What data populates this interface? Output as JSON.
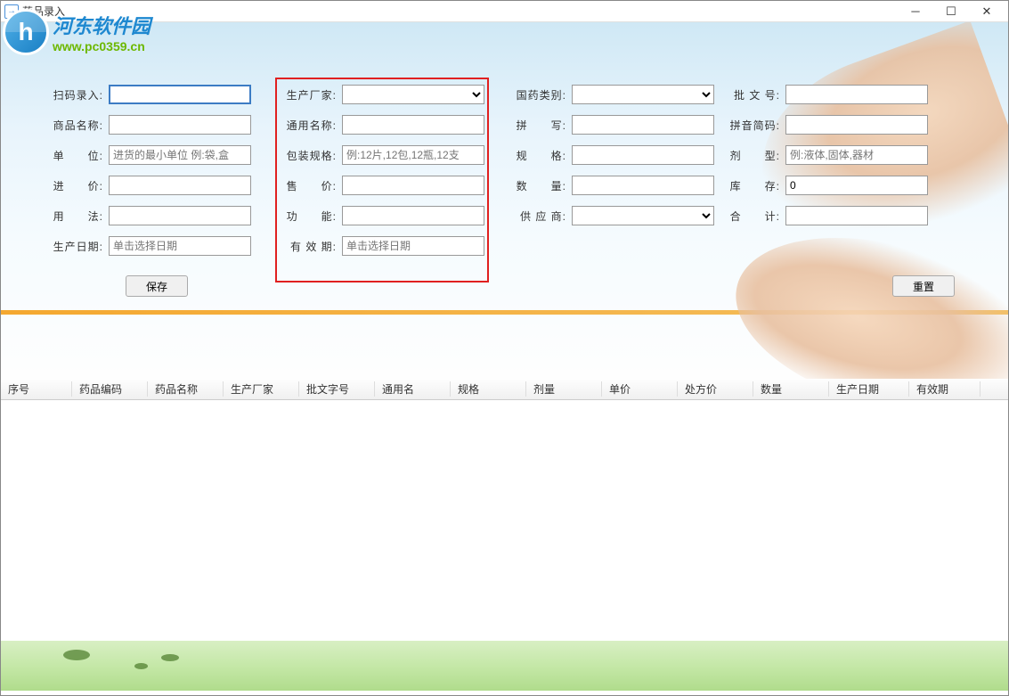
{
  "window": {
    "title": "药品录入"
  },
  "watermark": {
    "title": "河东软件园",
    "url": "www.pc0359.cn"
  },
  "labels": {
    "scan_input": "扫码录入:",
    "product_name": "商品名称:",
    "unit": "单　　位:",
    "purchase_price": "进　　价:",
    "usage": "用　　法:",
    "production_date": "生产日期:",
    "manufacturer": "生产厂家:",
    "generic_name": "通用名称:",
    "package_spec": "包装规格:",
    "sell_price": "售　　价:",
    "function": "功　　能:",
    "expiry_date": "有 效 期:",
    "drug_category": "国药类别:",
    "pinyin": "拼　　写:",
    "spec": "规　　格:",
    "quantity": "数　　量:",
    "supplier": "供 应 商:",
    "approval_num": "批 文 号:",
    "pinyin_short": "拼音简码:",
    "dosage_form": "剂　　型:",
    "stock": "库　　存:",
    "total": "合　　计:"
  },
  "placeholders": {
    "unit": "进货的最小单位 例:袋,盒",
    "package_spec": "例:12片,12包,12瓶,12支",
    "dosage_form": "例:液体,固体,器材",
    "production_date": "单击选择日期",
    "expiry_date": "单击选择日期"
  },
  "values": {
    "stock": "0"
  },
  "buttons": {
    "save": "保存",
    "reset": "重置"
  },
  "table": {
    "headers": [
      "序号",
      "药品编码",
      "药品名称",
      "生产厂家",
      "批文字号",
      "通用名",
      "规格",
      "剂量",
      "单价",
      "处方价",
      "数量",
      "生产日期",
      "有效期"
    ]
  }
}
